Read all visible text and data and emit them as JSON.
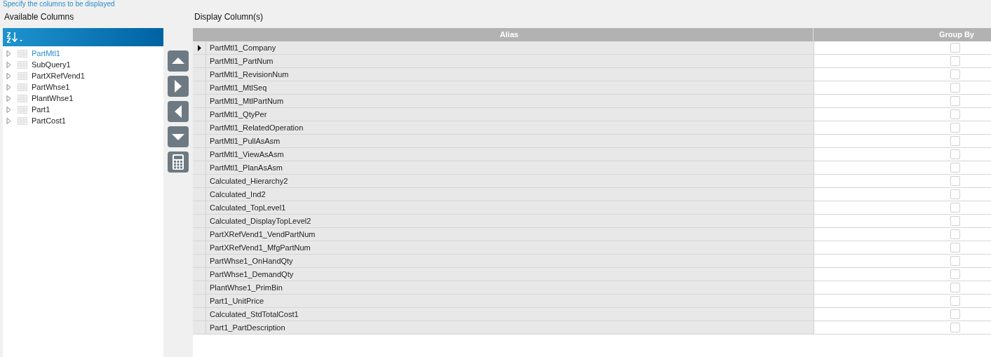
{
  "hint": "Specify the columns to be displayed",
  "available": {
    "title": "Available Columns",
    "items": [
      {
        "label": "PartMtl1",
        "selected": true,
        "expanded": false
      },
      {
        "label": "SubQuery1",
        "selected": false,
        "expanded": false
      },
      {
        "label": "PartXRefVend1",
        "selected": false,
        "expanded": false
      },
      {
        "label": "PartWhse1",
        "selected": false,
        "expanded": false
      },
      {
        "label": "PlantWhse1",
        "selected": false,
        "expanded": false
      },
      {
        "label": "Part1",
        "selected": false,
        "expanded": false
      },
      {
        "label": "PartCost1",
        "selected": false,
        "expanded": false
      }
    ]
  },
  "display": {
    "title": "Display Column(s)",
    "columns": [
      "Alias",
      "Group By"
    ],
    "rows": [
      {
        "alias": "PartMtl1_Company",
        "current": true,
        "group_by": false
      },
      {
        "alias": "PartMtl1_PartNum",
        "current": false,
        "group_by": false
      },
      {
        "alias": "PartMtl1_RevisionNum",
        "current": false,
        "group_by": false
      },
      {
        "alias": "PartMtl1_MtlSeq",
        "current": false,
        "group_by": false
      },
      {
        "alias": "PartMtl1_MtlPartNum",
        "current": false,
        "group_by": false
      },
      {
        "alias": "PartMtl1_QtyPer",
        "current": false,
        "group_by": false
      },
      {
        "alias": "PartMtl1_RelatedOperation",
        "current": false,
        "group_by": false
      },
      {
        "alias": "PartMtl1_PullAsAsm",
        "current": false,
        "group_by": false
      },
      {
        "alias": "PartMtl1_ViewAsAsm",
        "current": false,
        "group_by": false
      },
      {
        "alias": "PartMtl1_PlanAsAsm",
        "current": false,
        "group_by": false
      },
      {
        "alias": "Calculated_Hierarchy2",
        "current": false,
        "group_by": false
      },
      {
        "alias": "Calculated_Ind2",
        "current": false,
        "group_by": false
      },
      {
        "alias": "Calculated_TopLevel1",
        "current": false,
        "group_by": false
      },
      {
        "alias": "Calculated_DisplayTopLevel2",
        "current": false,
        "group_by": false
      },
      {
        "alias": "PartXRefVend1_VendPartNum",
        "current": false,
        "group_by": false
      },
      {
        "alias": "PartXRefVend1_MfgPartNum",
        "current": false,
        "group_by": false
      },
      {
        "alias": "PartWhse1_OnHandQty",
        "current": false,
        "group_by": false
      },
      {
        "alias": "PartWhse1_DemandQty",
        "current": false,
        "group_by": false
      },
      {
        "alias": "PlantWhse1_PrimBin",
        "current": false,
        "group_by": false
      },
      {
        "alias": "Part1_UnitPrice",
        "current": false,
        "group_by": false
      },
      {
        "alias": "Calculated_StdTotalCost1",
        "current": false,
        "group_by": false
      },
      {
        "alias": "Part1_PartDescription",
        "current": false,
        "group_by": false
      }
    ]
  }
}
